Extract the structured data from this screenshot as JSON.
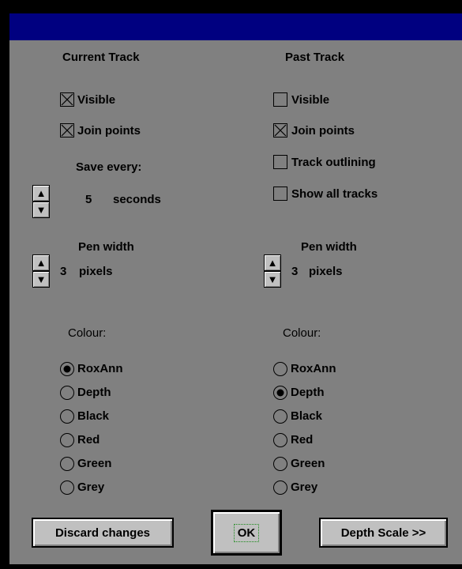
{
  "window": {
    "title": ""
  },
  "current_track": {
    "heading": "Current Track",
    "visible": {
      "label": "Visible",
      "checked": true
    },
    "join_points": {
      "label": "Join points",
      "checked": true
    },
    "save_every_label": "Save every:",
    "save_every_value": "5",
    "save_every_unit": "seconds",
    "pen_width_label": "Pen width",
    "pen_width_value": "3",
    "pen_width_unit": "pixels",
    "colour_label": "Colour:",
    "colours": [
      "RoxAnn",
      "Depth",
      "Black",
      "Red",
      "Green",
      "Grey"
    ],
    "selected_colour": "RoxAnn"
  },
  "past_track": {
    "heading": "Past Track",
    "visible": {
      "label": "Visible",
      "checked": false
    },
    "join_points": {
      "label": "Join points",
      "checked": true
    },
    "track_outlining": {
      "label": "Track outlining",
      "checked": false
    },
    "show_all_tracks": {
      "label": "Show all tracks",
      "checked": false
    },
    "pen_width_label": "Pen width",
    "pen_width_value": "3",
    "pen_width_unit": "pixels",
    "colour_label": "Colour:",
    "colours": [
      "RoxAnn",
      "Depth",
      "Black",
      "Red",
      "Green",
      "Grey"
    ],
    "selected_colour": "Depth"
  },
  "buttons": {
    "discard": "Discard changes",
    "ok": "OK",
    "depth_scale": "Depth Scale >>"
  },
  "icons": {
    "spin_up": "▲",
    "spin_down": "▼"
  },
  "colors": {
    "title_bar": "#000080",
    "face": "#808080",
    "button_face": "#c0c0c0"
  }
}
